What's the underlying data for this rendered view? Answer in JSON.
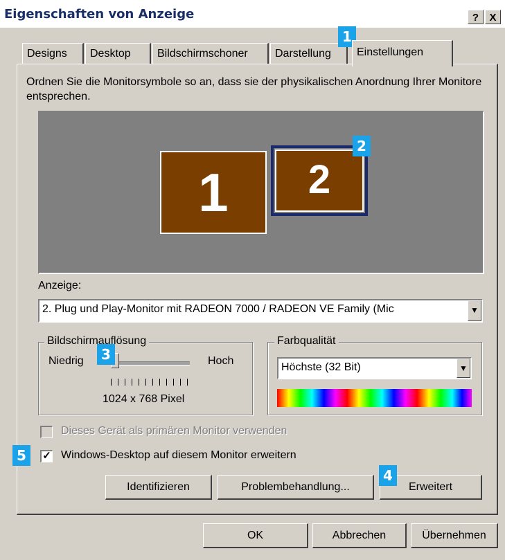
{
  "window": {
    "title": "Eigenschaften von Anzeige",
    "help_button": "?",
    "close_button": "X"
  },
  "tabs": [
    {
      "label": "Designs"
    },
    {
      "label": "Desktop"
    },
    {
      "label": "Bildschirmschoner"
    },
    {
      "label": "Darstellung"
    },
    {
      "label": "Einstellungen",
      "active": true
    }
  ],
  "instructions": "Ordnen Sie die Monitorsymbole so an, dass sie der physikalischen Anordnung Ihrer Monitore entsprechen.",
  "monitors": [
    {
      "number": "1",
      "selected": false
    },
    {
      "number": "2",
      "selected": true
    }
  ],
  "display": {
    "label": "Anzeige:",
    "value": "2. Plug und Play-Monitor mit RADEON 7000 / RADEON VE Family (Mic"
  },
  "resolution": {
    "group_label": "Bildschirmauflösung",
    "low_label": "Niedrig",
    "high_label": "Hoch",
    "value_text": "1024 x 768 Pixel",
    "slider_position": 0.0
  },
  "color_quality": {
    "group_label": "Farbqualität",
    "value": "Höchste (32 Bit)"
  },
  "checkboxes": {
    "primary": {
      "label": "Dieses Gerät als primären Monitor verwenden",
      "checked": false,
      "enabled": false
    },
    "extend": {
      "label": "Windows-Desktop auf diesem Monitor erweitern",
      "checked": true,
      "enabled": true
    }
  },
  "panel_buttons": {
    "identify": "Identifizieren",
    "troubleshoot": "Problembehandlung...",
    "advanced": "Erweitert"
  },
  "dialog_buttons": {
    "ok": "OK",
    "cancel": "Abbrechen",
    "apply": "Übernehmen"
  },
  "callouts": [
    "1",
    "2",
    "3",
    "4",
    "5"
  ],
  "colors": {
    "callout": "#1aa3e8",
    "monitor_fill": "#7a3f00",
    "selected_frame": "#1a2a6c",
    "dialog_bg": "#d4d0c8"
  }
}
